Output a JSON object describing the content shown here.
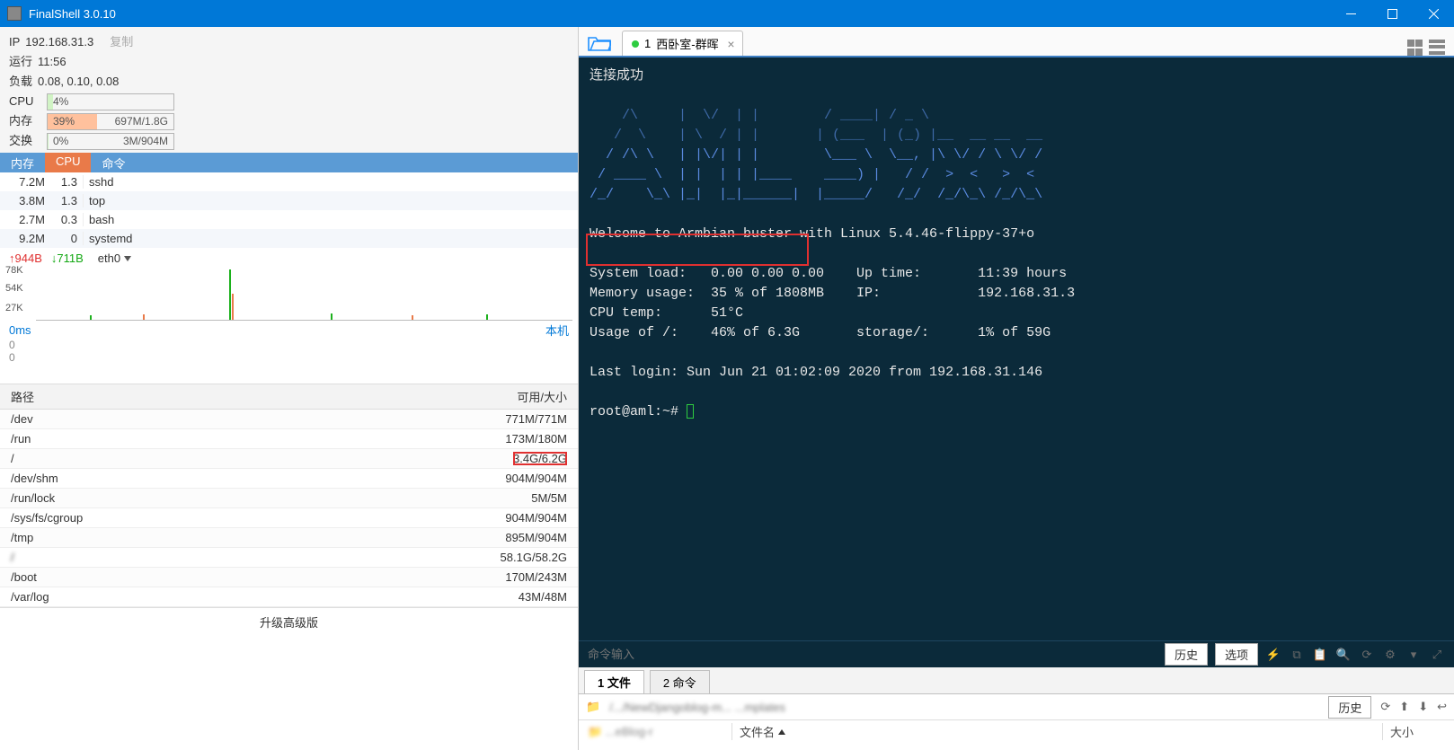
{
  "window": {
    "title": "FinalShell 3.0.10"
  },
  "sys": {
    "ip_label": "IP",
    "ip": "192.168.31.3",
    "copy": "复制",
    "runtime_label": "运行",
    "runtime": "11:56",
    "load_label": "负载",
    "load": "0.08, 0.10, 0.08",
    "cpu_label": "CPU",
    "cpu_pct": "4%",
    "mem_label": "内存",
    "mem_pct": "39%",
    "mem_txt": "697M/1.8G",
    "swap_label": "交换",
    "swap_pct": "0%",
    "swap_txt": "3M/904M"
  },
  "proc_tabs": {
    "t1": "内存",
    "t2": "CPU",
    "t3": "命令"
  },
  "procs": [
    {
      "mem": "7.2M",
      "cpu": "1.3",
      "name": "sshd"
    },
    {
      "mem": "3.8M",
      "cpu": "1.3",
      "name": "top"
    },
    {
      "mem": "2.7M",
      "cpu": "0.3",
      "name": "bash"
    },
    {
      "mem": "9.2M",
      "cpu": "0",
      "name": "systemd"
    }
  ],
  "net": {
    "up": "944B",
    "down": "711B",
    "iface": "eth0",
    "y": [
      "78K",
      "54K",
      "27K"
    ]
  },
  "ping": {
    "ms": "0ms",
    "host": "本机",
    "z1": "0",
    "z2": "0"
  },
  "disk_head": {
    "path": "路径",
    "avail": "可用/大小"
  },
  "disks": [
    {
      "p": "/dev",
      "s": "771M/771M"
    },
    {
      "p": "/run",
      "s": "173M/180M"
    },
    {
      "p": "/",
      "s": "3.4G/6.2G",
      "hilite": true
    },
    {
      "p": "/dev/shm",
      "s": "904M/904M"
    },
    {
      "p": "/run/lock",
      "s": "5M/5M"
    },
    {
      "p": "/sys/fs/cgroup",
      "s": "904M/904M"
    },
    {
      "p": "/tmp",
      "s": "895M/904M"
    },
    {
      "p": "/",
      "s": "58.1G/58.2G",
      "blur": true
    },
    {
      "p": "/boot",
      "s": "170M/243M"
    },
    {
      "p": "/var/log",
      "s": "43M/48M"
    }
  ],
  "upgrade": "升级高级版",
  "conn_tab": {
    "index": "1",
    "title": "西卧室-群晖"
  },
  "term": {
    "ok": "连接成功",
    "ascii": [
      "    /\\     |  \\/  | |        / ____| / _ \\               ",
      "   /  \\    | \\  / | |       | (___  | (_) |__  __ __  __ ",
      "  / /\\ \\   | |\\/| | |        \\___ \\  \\__, |\\ \\/ / \\ \\/ / ",
      " / ____ \\  | |  | | |____    ____) |   / /  >  <   >  <  ",
      "/_/    \\_\\ |_|  |_|______|  |_____/   /_/  /_/\\_\\ /_/\\_\\ "
    ],
    "welcome": "Welcome to Armbian buster with Linux 5.4.46-flippy-37+o",
    "info": {
      "sysload_l": "System load:",
      "sysload_v": "0.00 0.00 0.00",
      "uptime_l": "Up time:",
      "uptime_v": "11:39 hours",
      "mem_l": "Memory usage:",
      "mem_v": "35 % of 1808MB",
      "ip_l": "IP:",
      "ip_v": "192.168.31.3",
      "cput_l": "CPU temp:",
      "cput_v": "51°C",
      "usage_l": "Usage of /:",
      "usage_v": "46% of 6.3G",
      "stor_l": "storage/:",
      "stor_v": "1% of 59G"
    },
    "last": "Last login: Sun Jun 21 01:02:09 2020 from 192.168.31.146",
    "prompt": "root@aml:~# "
  },
  "cmdbar": {
    "ph": "命令输入",
    "history": "历史",
    "options": "选项"
  },
  "bottom_tabs": {
    "t1": "1 文件",
    "t2": "2 命令"
  },
  "fbrowser": {
    "path": "/.../NewDjangoblog-m... ...mplates",
    "history": "历史",
    "folder_hint": "...eBlog-r",
    "name_col": "文件名",
    "size_col": "大小"
  }
}
